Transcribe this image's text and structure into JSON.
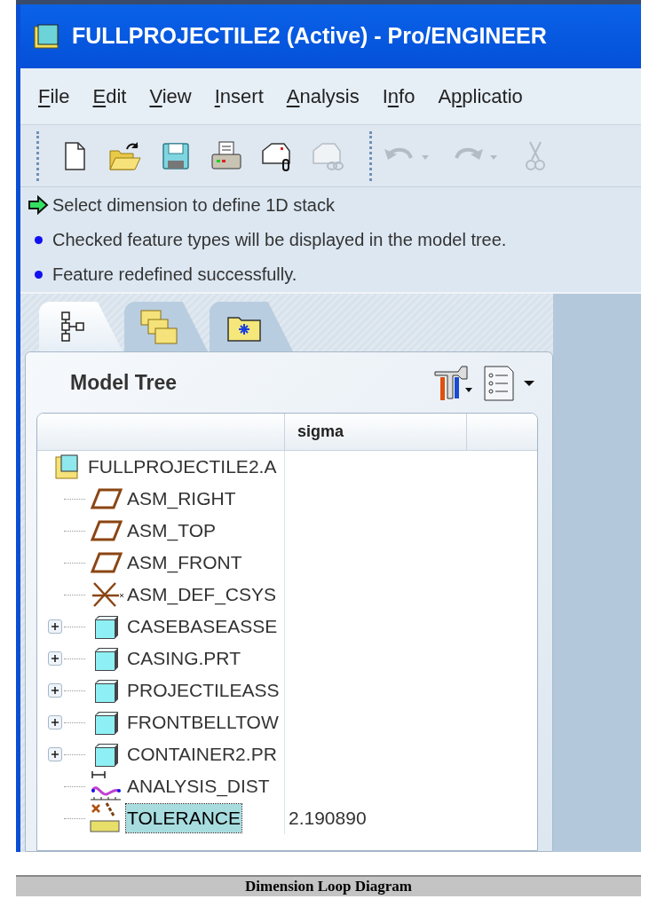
{
  "window": {
    "title": "FULLPROJECTILE2 (Active) - Pro/ENGINEER"
  },
  "menu": [
    {
      "key": "F",
      "after": "ile"
    },
    {
      "key": "E",
      "after": "dit"
    },
    {
      "key": "V",
      "after": "iew"
    },
    {
      "key": "I",
      "after": "nsert"
    },
    {
      "key": "A",
      "after": "nalysis"
    },
    {
      "before": "I",
      "key": "n",
      "after": "fo"
    },
    {
      "before": "A",
      "key": "p",
      "after": "plicatio"
    }
  ],
  "toolbar": [
    {
      "kind": "new",
      "disabled": false
    },
    {
      "kind": "open",
      "disabled": false
    },
    {
      "kind": "save",
      "disabled": false
    },
    {
      "kind": "print",
      "disabled": false
    },
    {
      "kind": "mail",
      "disabled": false
    },
    {
      "kind": "mail-link",
      "disabled": true
    },
    {
      "kind": "undo",
      "disabled": true
    },
    {
      "kind": "redo",
      "disabled": true
    },
    {
      "kind": "cut",
      "disabled": true
    }
  ],
  "messages": [
    {
      "kind": "prompt",
      "text": "Select dimension to define 1D stack"
    },
    {
      "kind": "info",
      "text": "Checked feature types will be displayed in the model tree."
    },
    {
      "kind": "info",
      "text": "Feature redefined successfully."
    }
  ],
  "tabs": [
    {
      "kind": "tree",
      "selected": true
    },
    {
      "kind": "folders",
      "selected": false
    },
    {
      "kind": "favorites",
      "selected": false
    }
  ],
  "model_tree": {
    "title": "Model Tree",
    "columns": [
      "sigma"
    ],
    "root": {
      "kind": "root",
      "label": "FULLPROJECTILE2.A",
      "selected": false,
      "children": [
        {
          "kind": "plane",
          "label": "ASM_RIGHT",
          "selected": false
        },
        {
          "kind": "plane",
          "label": "ASM_TOP",
          "selected": false
        },
        {
          "kind": "plane",
          "label": "ASM_FRONT",
          "selected": false
        },
        {
          "kind": "csys",
          "label": "ASM_DEF_CSYS",
          "selected": false
        },
        {
          "kind": "part",
          "label": "CASEBASEASSE",
          "selected": false,
          "expanded": false
        },
        {
          "kind": "part",
          "label": "CASING.PRT",
          "selected": false,
          "expanded": false
        },
        {
          "kind": "part",
          "label": "PROJECTILEASS",
          "selected": false,
          "expanded": false
        },
        {
          "kind": "part",
          "label": "FRONTBELLTOW",
          "selected": false,
          "expanded": false
        },
        {
          "kind": "part",
          "label": "CONTAINER2.PR",
          "selected": false,
          "expanded": false
        },
        {
          "kind": "analysis",
          "label": "ANALYSIS_DIST",
          "selected": false
        },
        {
          "kind": "tolerance",
          "label": "TOLERANCE",
          "selected": true,
          "sigma": "2.190890"
        }
      ]
    }
  },
  "caption": "Dimension Loop Diagram"
}
